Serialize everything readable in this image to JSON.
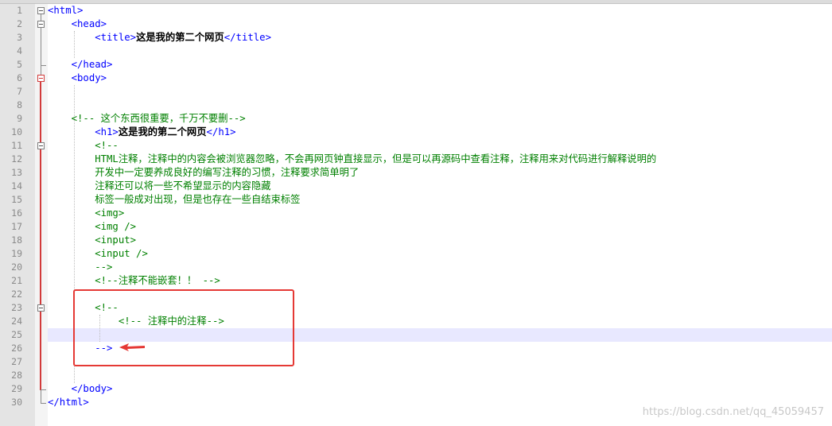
{
  "editor": {
    "lines": [
      {
        "num": "1",
        "parts": [
          {
            "c": "tag",
            "t": "<html>"
          }
        ]
      },
      {
        "num": "2",
        "parts": [
          {
            "c": "tag",
            "t": "    <head>"
          }
        ]
      },
      {
        "num": "3",
        "parts": [
          {
            "c": "tag",
            "t": "        <title>"
          },
          {
            "c": "txt",
            "t": "这是我的第二个网页"
          },
          {
            "c": "tag",
            "t": "</title>"
          }
        ]
      },
      {
        "num": "4",
        "parts": []
      },
      {
        "num": "5",
        "parts": [
          {
            "c": "tag",
            "t": "    </head>"
          }
        ]
      },
      {
        "num": "6",
        "parts": [
          {
            "c": "tag",
            "t": "    <body>"
          }
        ]
      },
      {
        "num": "7",
        "parts": []
      },
      {
        "num": "8",
        "parts": []
      },
      {
        "num": "9",
        "parts": [
          {
            "c": "cmt",
            "t": "    <!-- 这个东西很重要，千万不要删-->"
          }
        ]
      },
      {
        "num": "10",
        "parts": [
          {
            "c": "tag",
            "t": "        <h1>"
          },
          {
            "c": "txt",
            "t": "这是我的第二个网页"
          },
          {
            "c": "tag",
            "t": "</h1>"
          }
        ]
      },
      {
        "num": "11",
        "parts": [
          {
            "c": "cmt",
            "t": "        <!--"
          }
        ]
      },
      {
        "num": "12",
        "parts": [
          {
            "c": "cmt",
            "t": "        HTML注释，注释中的内容会被浏览器忽略，不会再网页钟直接显示，但是可以再源码中查看注释，注释用来对代码进行解释说明的"
          }
        ]
      },
      {
        "num": "13",
        "parts": [
          {
            "c": "cmt",
            "t": "        开发中一定要养成良好的编写注释的习惯，注释要求简单明了"
          }
        ]
      },
      {
        "num": "14",
        "parts": [
          {
            "c": "cmt",
            "t": "        注释还可以将一些不希望显示的内容隐藏"
          }
        ]
      },
      {
        "num": "15",
        "parts": [
          {
            "c": "cmt",
            "t": "        标签一般成对出现，但是也存在一些自结束标签"
          }
        ]
      },
      {
        "num": "16",
        "parts": [
          {
            "c": "cmt",
            "t": "        <img>"
          }
        ]
      },
      {
        "num": "17",
        "parts": [
          {
            "c": "cmt",
            "t": "        <img />"
          }
        ]
      },
      {
        "num": "18",
        "parts": [
          {
            "c": "cmt",
            "t": "        <input>"
          }
        ]
      },
      {
        "num": "19",
        "parts": [
          {
            "c": "cmt",
            "t": "        <input />"
          }
        ]
      },
      {
        "num": "20",
        "parts": [
          {
            "c": "cmt",
            "t": "        -->"
          }
        ]
      },
      {
        "num": "21",
        "parts": [
          {
            "c": "cmt",
            "t": "        <!--注释不能嵌套！！ -->"
          }
        ]
      },
      {
        "num": "22",
        "parts": []
      },
      {
        "num": "23",
        "parts": [
          {
            "c": "cmt",
            "t": "        <!--"
          }
        ]
      },
      {
        "num": "24",
        "parts": [
          {
            "c": "cmt",
            "t": "            <!-- 注释中的注释-->"
          }
        ]
      },
      {
        "num": "25",
        "parts": []
      },
      {
        "num": "26",
        "parts": [
          {
            "c": "tag",
            "t": "        -->"
          }
        ]
      },
      {
        "num": "27",
        "parts": []
      },
      {
        "num": "28",
        "parts": []
      },
      {
        "num": "29",
        "parts": [
          {
            "c": "tag",
            "t": "    </body>"
          }
        ]
      },
      {
        "num": "30",
        "parts": [
          {
            "c": "tag",
            "t": "</html>"
          }
        ]
      }
    ]
  },
  "colors": {
    "tag": "#0000ff",
    "comment": "#008000",
    "text": "#000000",
    "annotation": "#e53935",
    "current_line": "#e8e8ff"
  },
  "watermark": "https://blog.csdn.net/qq_45059457"
}
